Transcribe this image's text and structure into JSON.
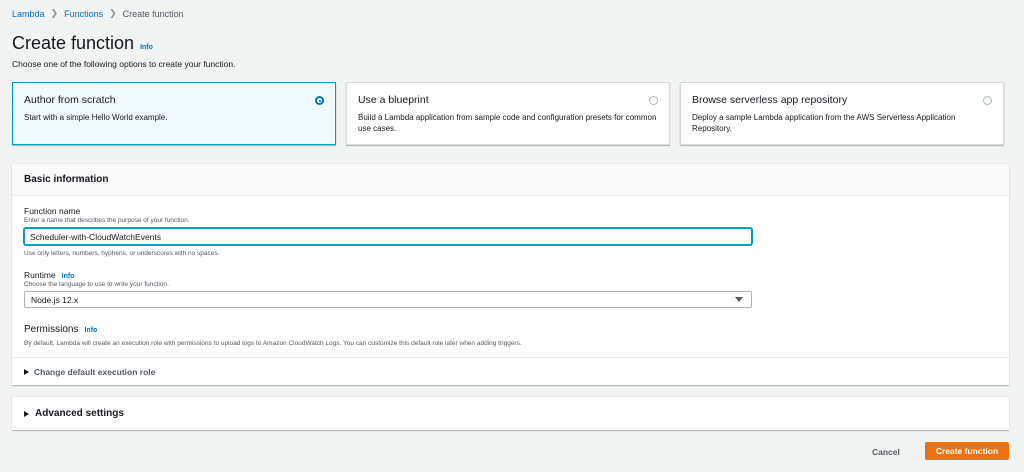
{
  "breadcrumb": {
    "items": [
      "Lambda",
      "Functions",
      "Create function"
    ]
  },
  "header": {
    "title": "Create function",
    "info": "Info",
    "subtitle": "Choose one of the following options to create your function."
  },
  "options": [
    {
      "title": "Author from scratch",
      "desc": "Start with a simple Hello World example.",
      "selected": true
    },
    {
      "title": "Use a blueprint",
      "desc": "Build a Lambda application from sample code and configuration presets for common use cases.",
      "selected": false
    },
    {
      "title": "Browse serverless app repository",
      "desc": "Deploy a sample Lambda application from the AWS Serverless Application Repository.",
      "selected": false
    }
  ],
  "basic_info": {
    "title": "Basic information",
    "function_name": {
      "label": "Function name",
      "desc": "Enter a name that describes the purpose of your function.",
      "value": "Scheduler-with-CloudWatchEvents",
      "hint": "Use only letters, numbers, hyphens, or underscores with no spaces."
    },
    "runtime": {
      "label": "Runtime",
      "info": "Info",
      "desc": "Choose the language to use to write your function.",
      "value": "Node.js 12.x"
    },
    "permissions": {
      "label": "Permissions",
      "info": "Info",
      "desc": "By default, Lambda will create an execution role with permissions to upload logs to Amazon CloudWatch Logs. You can customize this default role later when adding triggers."
    },
    "exec_role_label": "Change default execution role"
  },
  "advanced": {
    "label": "Advanced settings"
  },
  "footer": {
    "cancel": "Cancel",
    "create": "Create function"
  },
  "colors": {
    "primary_button": "#ec7211",
    "link": "#0073bb",
    "selected_border": "#00a1c9"
  }
}
